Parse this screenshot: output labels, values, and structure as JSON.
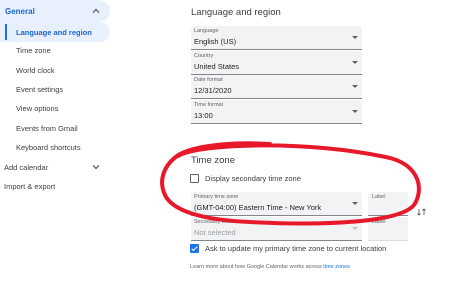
{
  "sidebar": {
    "general_label": "General",
    "items": [
      {
        "label": "Language and region",
        "active": true
      },
      {
        "label": "Time zone"
      },
      {
        "label": "World clock"
      },
      {
        "label": "Event settings"
      },
      {
        "label": "View options"
      },
      {
        "label": "Events from Gmail"
      },
      {
        "label": "Keyboard shortcuts"
      }
    ],
    "add_calendar_label": "Add calendar",
    "import_export_label": "Import & export"
  },
  "language_region": {
    "title": "Language and region",
    "fields": [
      {
        "label": "Language",
        "value": "English (US)"
      },
      {
        "label": "Country",
        "value": "United States"
      },
      {
        "label": "Date format",
        "value": "12/31/2020"
      },
      {
        "label": "Time format",
        "value": "13:00"
      }
    ]
  },
  "time_zone": {
    "title": "Time zone",
    "display_secondary_label": "Display secondary time zone",
    "display_secondary_checked": false,
    "primary": {
      "label": "Primary time zone",
      "value": "(GMT-04:00) Eastern Time - New York"
    },
    "primary_label_field": {
      "label": "Label"
    },
    "secondary": {
      "label": "Secondary time zone",
      "value": "Not selected"
    },
    "secondary_label_field": {
      "label": "Label"
    },
    "ask_update_label": "Ask to update my primary time zone to current location",
    "ask_update_checked": true,
    "learn_more_text": "Learn more about how Google Calendar works across ",
    "learn_more_link": "time zones"
  },
  "colors": {
    "accent": "#1a73e8",
    "active_bg": "#e8f0fe",
    "annotation_red": "#e8182b"
  }
}
